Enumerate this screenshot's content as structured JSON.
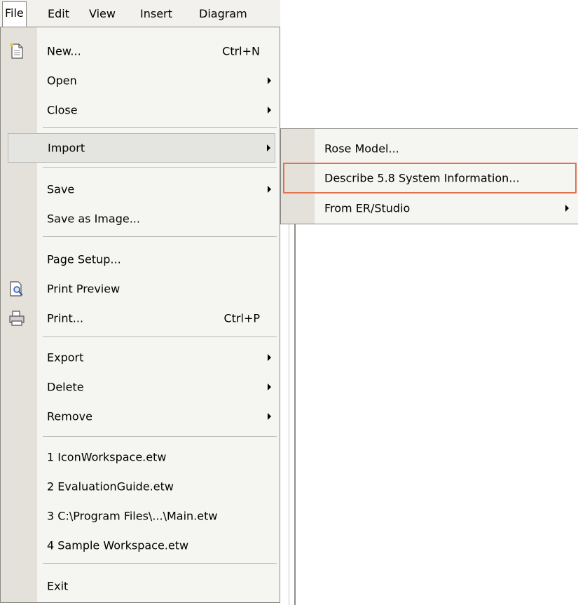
{
  "menubar": {
    "items": [
      {
        "label": "File",
        "active": true
      },
      {
        "label": "Edit"
      },
      {
        "label": "View"
      },
      {
        "label": "Insert"
      },
      {
        "label": "Diagram"
      }
    ]
  },
  "file_menu": {
    "items": [
      {
        "label": "New...",
        "shortcut": "Ctrl+N",
        "icon": "new-document-icon"
      },
      {
        "label": "Open",
        "submenu": true
      },
      {
        "label": "Close",
        "submenu": true
      },
      {
        "label": "Import",
        "submenu": true,
        "highlighted": true
      },
      {
        "label": "Save",
        "submenu": true
      },
      {
        "label": "Save as Image..."
      },
      {
        "label": "Page Setup..."
      },
      {
        "label": "Print Preview",
        "icon": "print-preview-icon"
      },
      {
        "label": "Print...",
        "shortcut": "Ctrl+P",
        "icon": "printer-icon"
      },
      {
        "label": "Export",
        "submenu": true
      },
      {
        "label": "Delete",
        "submenu": true
      },
      {
        "label": "Remove",
        "submenu": true
      },
      {
        "label": "1 IconWorkspace.etw"
      },
      {
        "label": "2 EvaluationGuide.etw"
      },
      {
        "label": "3 C:\\Program Files\\...\\Main.etw"
      },
      {
        "label": "4 Sample Workspace.etw"
      },
      {
        "label": "Exit"
      }
    ]
  },
  "import_submenu": {
    "items": [
      {
        "label": "Rose Model..."
      },
      {
        "label": "Describe 5.8 System Information...",
        "selected": true
      },
      {
        "label": "From ER/Studio",
        "submenu": true
      }
    ]
  },
  "colors": {
    "menu_background": "#f5f5f2",
    "gutter": "#e3e1da",
    "highlight": "#e4e4e1",
    "selection_border": "#e0734e"
  }
}
